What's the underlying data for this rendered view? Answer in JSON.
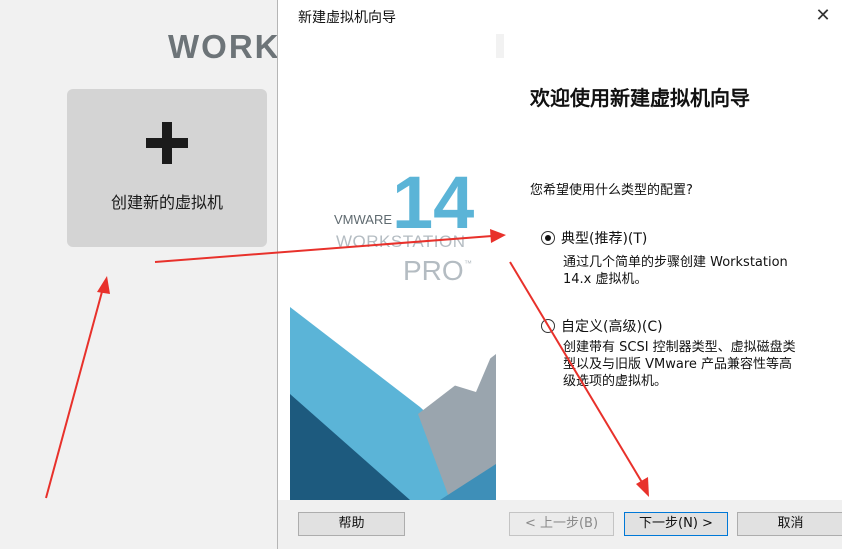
{
  "background": {
    "brand_text": "WORKS",
    "tile_label": "创建新的虚拟机"
  },
  "dialog": {
    "title": "新建虚拟机向导",
    "heading": "欢迎使用新建虚拟机向导",
    "question": "您希望使用什么类型的配置?",
    "logo": {
      "version": "14",
      "vendor": "VMWARE",
      "product": "WORKSTATION",
      "edition": "PRO",
      "trademark": "™"
    },
    "options": [
      {
        "label": "典型(推荐)(T)",
        "selected": true,
        "description": [
          "通过几个简单的步骤创建 Workstation",
          "14.x 虚拟机。"
        ]
      },
      {
        "label": "自定义(高级)(C)",
        "selected": false,
        "description": [
          "创建带有 SCSI 控制器类型、虚拟磁盘类",
          "型以及与旧版 VMware 产品兼容性等高",
          "级选项的虚拟机。"
        ]
      }
    ],
    "buttons": {
      "help": "帮助",
      "back": "< 上一步(B)",
      "next": "下一步(N) >",
      "cancel": "取消"
    }
  },
  "colors": {
    "annotation_arrow": "#e8312b",
    "logo_blue": "#5bb4d7",
    "logo_navy": "#1d5a7e",
    "panel_gray": "#9aa5ae"
  }
}
